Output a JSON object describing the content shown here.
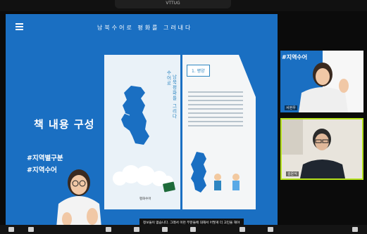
{
  "window": {
    "top_label": "VTTUG"
  },
  "slide": {
    "header_title": "남북수어로 평화를 그려내다",
    "big_title": "책 내용 구성",
    "tags": [
      "#지역별구분",
      "#지역수어"
    ]
  },
  "book": {
    "left_vertical": [
      "수어로",
      "남북평화를 그리다"
    ],
    "logo_text": "평화수어",
    "right_chapter": "1. 평양"
  },
  "caption": {
    "text": "정보들이 없습니다. 그래서 이런 부분들에 대해서 어떻게 더 고민을 해야 할 것인지, 그리고 우리가 북한 이웃들 같은 때 대한 정보를 가져야 할 것인지 특별히"
  },
  "participants": [
    {
      "tag": "#지역수어",
      "name": "서현우"
    },
    {
      "tag": "",
      "name": "김은식"
    }
  ],
  "colors": {
    "slide_bg": "#1a6fc2",
    "active_speaker_border": "#b6e21c"
  }
}
